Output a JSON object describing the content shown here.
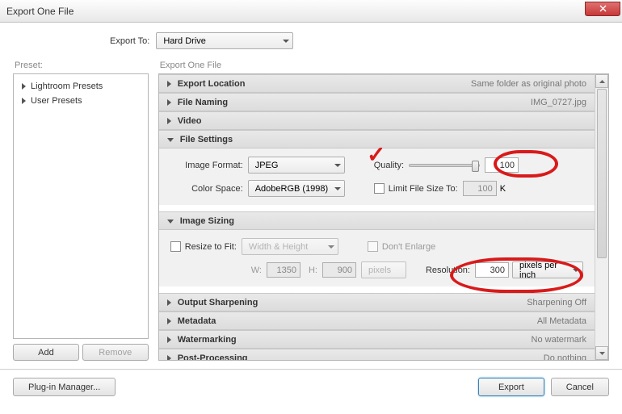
{
  "window": {
    "title": "Export One File"
  },
  "export_to": {
    "label": "Export To:",
    "value": "Hard Drive"
  },
  "preset": {
    "label": "Preset:",
    "items": [
      {
        "label": "Lightroom Presets"
      },
      {
        "label": "User Presets"
      }
    ],
    "add": "Add",
    "remove": "Remove"
  },
  "right_header": "Export One File",
  "sections": {
    "export_location": {
      "title": "Export Location",
      "summary": "Same folder as original photo"
    },
    "file_naming": {
      "title": "File Naming",
      "summary": "IMG_0727.jpg"
    },
    "video": {
      "title": "Video"
    },
    "file_settings": {
      "title": "File Settings",
      "image_format_label": "Image Format:",
      "image_format": "JPEG",
      "quality_label": "Quality:",
      "quality_value": "100",
      "color_space_label": "Color Space:",
      "color_space": "AdobeRGB (1998)",
      "limit_label": "Limit File Size To:",
      "limit_value": "100",
      "limit_unit": "K"
    },
    "image_sizing": {
      "title": "Image Sizing",
      "resize_label": "Resize to Fit:",
      "resize_mode": "Width & Height",
      "dont_enlarge": "Don't Enlarge",
      "w_label": "W:",
      "w_value": "1350",
      "h_label": "H:",
      "h_value": "900",
      "unit": "pixels",
      "resolution_label": "Resolution:",
      "resolution_value": "300",
      "resolution_unit": "pixels per inch"
    },
    "output_sharpening": {
      "title": "Output Sharpening",
      "summary": "Sharpening Off"
    },
    "metadata": {
      "title": "Metadata",
      "summary": "All Metadata"
    },
    "watermarking": {
      "title": "Watermarking",
      "summary": "No watermark"
    },
    "post_processing": {
      "title": "Post-Processing",
      "summary": "Do nothing"
    }
  },
  "footer": {
    "plugin_manager": "Plug-in Manager...",
    "export": "Export",
    "cancel": "Cancel"
  }
}
